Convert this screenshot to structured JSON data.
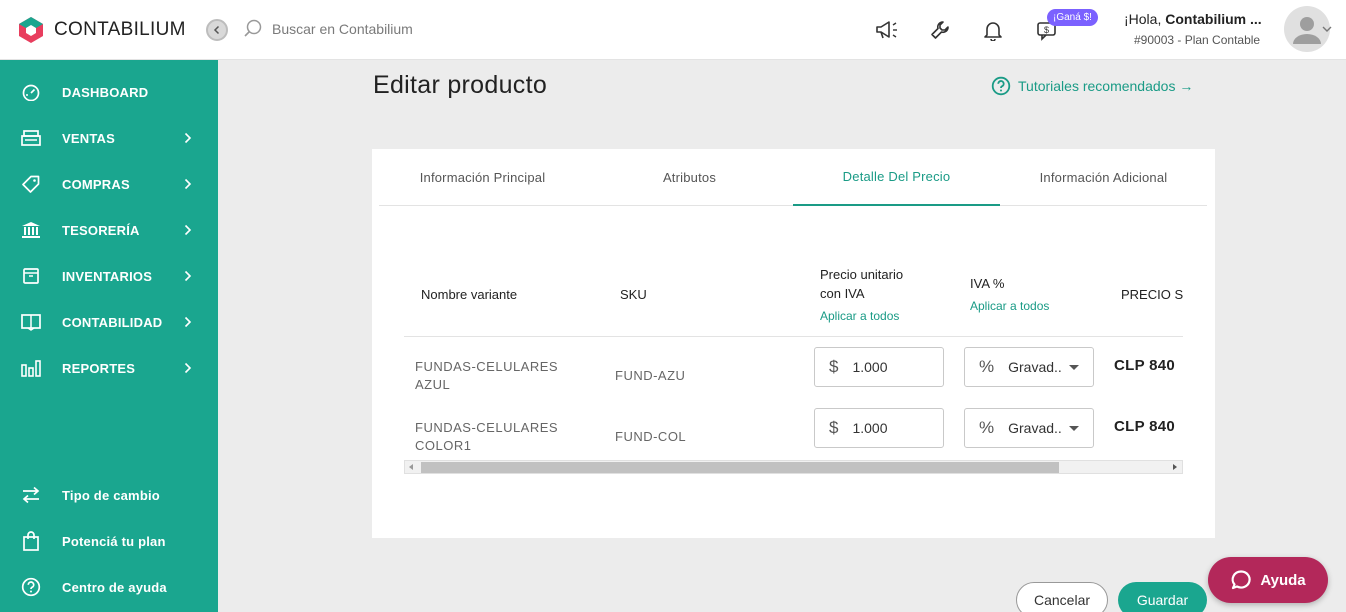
{
  "app": {
    "name": "CONTABILIUM",
    "brand_color": "#1aa68f",
    "accent_color": "#b3285a"
  },
  "topbar": {
    "search_placeholder": "Buscar en Contabilium",
    "badge": "¡Ganá $!",
    "greeting_prefix": "¡Hola, ",
    "greeting_name": "Contabilium ...",
    "plan": "#90003 - Plan Contable",
    "icons": [
      "megaphone-icon",
      "wrench-icon",
      "bell-icon",
      "referral-icon",
      "user-icon"
    ]
  },
  "sidebar": {
    "items": [
      {
        "label": "DASHBOARD",
        "icon": "dashboard-icon"
      },
      {
        "label": "VENTAS",
        "icon": "register-icon"
      },
      {
        "label": "COMPRAS",
        "icon": "tag-icon"
      },
      {
        "label": "TESORERÍA",
        "icon": "bank-icon"
      },
      {
        "label": "INVENTARIOS",
        "icon": "box-icon"
      },
      {
        "label": "CONTABILIDAD",
        "icon": "book-icon"
      },
      {
        "label": "REPORTES",
        "icon": "chart-icon"
      }
    ],
    "bottom": [
      {
        "label": "Tipo de cambio",
        "icon": "exchange-icon"
      },
      {
        "label": "Potenciá tu plan",
        "icon": "bag-icon"
      },
      {
        "label": "Centro de ayuda",
        "icon": "help-icon"
      }
    ]
  },
  "page": {
    "title": "Editar producto",
    "tutorials": "Tutoriales recomendados →"
  },
  "tabs": [
    {
      "label": "Información Principal",
      "active": false
    },
    {
      "label": "Atributos",
      "active": false
    },
    {
      "label": "Detalle Del Precio",
      "active": true
    },
    {
      "label": "Información Adicional",
      "active": false
    }
  ],
  "table": {
    "columns": {
      "name": "Nombre variante",
      "sku": "SKU",
      "price_l1": "Precio unitario",
      "price_l2": "con IVA",
      "apply_all": "Aplicar a todos",
      "iva": "IVA %",
      "precio_sin": "PRECIO SI"
    },
    "rows": [
      {
        "name_l1": "FUNDAS-CELULARES",
        "name_l2": "AZUL",
        "sku": "FUND-AZU",
        "price_symbol": "$",
        "price": "1.000",
        "iva_symbol": "%",
        "iva": "Gravad..",
        "total": "CLP 840"
      },
      {
        "name_l1": "FUNDAS-CELULARES",
        "name_l2": "COLOR1",
        "sku": "FUND-COL",
        "price_symbol": "$",
        "price": "1.000",
        "iva_symbol": "%",
        "iva": "Gravad..",
        "total": "CLP 840"
      }
    ]
  },
  "actions": {
    "cancel": "Cancelar",
    "save": "Guardar",
    "help": "Ayuda"
  }
}
